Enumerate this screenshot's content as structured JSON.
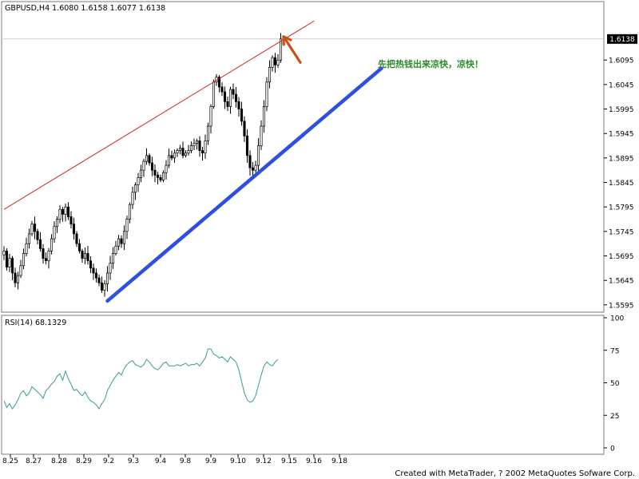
{
  "colors": {
    "background": "#ffffff",
    "frame": "#7a7a7a",
    "candle": "#000000",
    "rsi_line": "#3a9a9a",
    "resistance_line": "#cc2a2a",
    "support_line": "#2f4fe0",
    "arrow": "#c8501a",
    "annotation": "#2c8a2c"
  },
  "chart_data": [
    {
      "type": "candlestick",
      "title": "GBPUSD,H4  1.6080 1.6158 1.6077 1.6138",
      "ylim": [
        1.5585,
        1.6185
      ],
      "y_ticks": [
        "1.6095",
        "1.6045",
        "1.5995",
        "1.5945",
        "1.5895",
        "1.5845",
        "1.5795",
        "1.5745",
        "1.5695",
        "1.5645",
        "1.5595"
      ],
      "current_price": "1.6138",
      "x_ticks": [
        "8.25",
        "8.27",
        "8.28",
        "8.29",
        "9.2",
        "9.3",
        "9.4",
        "9.8",
        "9.9",
        "9.10",
        "9.12",
        "9.15",
        "9.16",
        "9.18"
      ],
      "close_series": [
        1.5705,
        1.5672,
        1.569,
        1.566,
        1.564,
        1.5655,
        1.5675,
        1.57,
        1.572,
        1.574,
        1.576,
        1.5745,
        1.5728,
        1.571,
        1.569,
        1.5685,
        1.5705,
        1.573,
        1.5755,
        1.577,
        1.579,
        1.578,
        1.5795,
        1.5775,
        1.576,
        1.574,
        1.572,
        1.5705,
        1.569,
        1.57,
        1.5685,
        1.567,
        1.566,
        1.565,
        1.564,
        1.5625,
        1.5638,
        1.566,
        1.568,
        1.57,
        1.5715,
        1.573,
        1.572,
        1.5745,
        1.577,
        1.58,
        1.5825,
        1.584,
        1.5855,
        1.587,
        1.5888,
        1.59,
        1.5885,
        1.587,
        1.586,
        1.5855,
        1.585,
        1.5865,
        1.588,
        1.59,
        1.5895,
        1.5905,
        1.591,
        1.5915,
        1.59,
        1.5905,
        1.591,
        1.592,
        1.5925,
        1.593,
        1.591,
        1.5905,
        1.593,
        1.596,
        1.6,
        1.605,
        1.606,
        1.604,
        1.603,
        1.601,
        1.6,
        1.6035,
        1.6025,
        1.601,
        1.5995,
        1.597,
        1.594,
        1.59,
        1.5875,
        1.587,
        1.588,
        1.592,
        1.596,
        1.6,
        1.605,
        1.608,
        1.61,
        1.6085,
        1.6095,
        1.6138
      ],
      "annotations": {
        "resistance_line": {
          "from": {
            "bar": 0,
            "price": 1.579
          },
          "to": {
            "bar": 111,
            "price": 1.6175
          }
        },
        "support_line": {
          "from": {
            "bar": 37,
            "price": 1.5603
          },
          "to": {
            "bar": 135,
            "price": 1.6078
          }
        },
        "arrow": {
          "from": {
            "bar": 106,
            "price": 1.609
          },
          "to": {
            "bar": 100,
            "price": 1.6143
          }
        },
        "note": "先把热钱出来凉快，凉快！"
      }
    },
    {
      "type": "line",
      "title": "RSI(14)  68.1329",
      "ylim": [
        0,
        100
      ],
      "y_ticks": [
        "100",
        "75",
        "50",
        "25",
        "0"
      ],
      "values": [
        36,
        31,
        34,
        30,
        33,
        37,
        42,
        44,
        40,
        42,
        47,
        45,
        43,
        41,
        38,
        44,
        46,
        49,
        51,
        55,
        57,
        52,
        59,
        53,
        49,
        44,
        45,
        42,
        40,
        43,
        39,
        36,
        35,
        33,
        30,
        34,
        37,
        44,
        48,
        52,
        55,
        58,
        56,
        61,
        64,
        66,
        67,
        64,
        63,
        62,
        64,
        68,
        66,
        63,
        61,
        60,
        62,
        65,
        66,
        63,
        63,
        63,
        64,
        63,
        64,
        65,
        63,
        64,
        64,
        65,
        63,
        66,
        69,
        76,
        76,
        72,
        71,
        69,
        70,
        68,
        66,
        70,
        68,
        66,
        60,
        51,
        42,
        37,
        35,
        36,
        40,
        48,
        56,
        63,
        66,
        64,
        63,
        66,
        68
      ]
    }
  ],
  "footer": "Created with MetaTrader, ? 2002 MetaQuotes Sofware Corp."
}
